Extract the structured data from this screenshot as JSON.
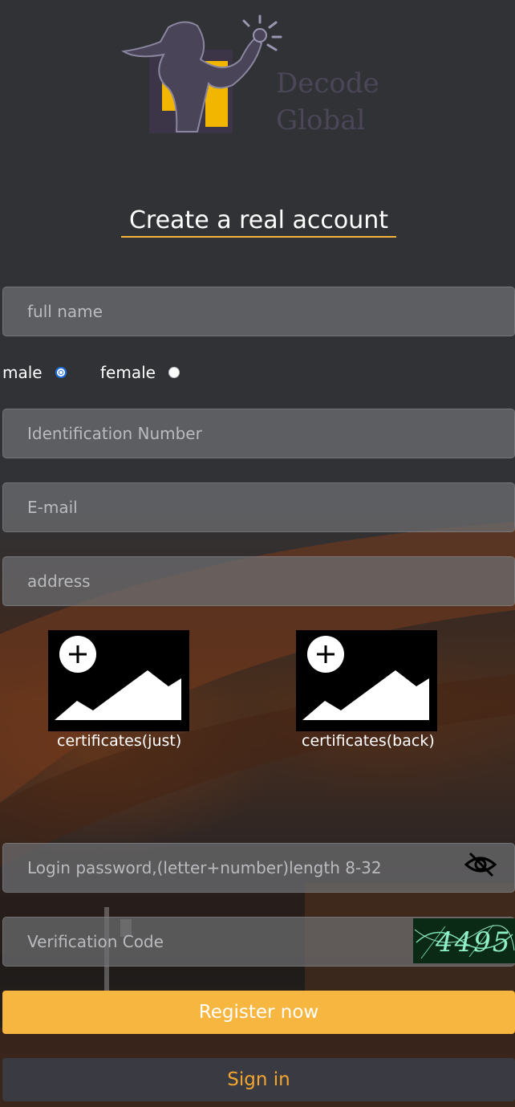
{
  "brand": {
    "line1": "Decode",
    "line2": "Global"
  },
  "form": {
    "title": "Create a real account",
    "full_name_placeholder": "full name",
    "gender": {
      "male": "male",
      "female": "female",
      "selected": "male"
    },
    "id_placeholder": "Identification Number",
    "email_placeholder": "E-mail",
    "address_placeholder": "address",
    "uploads": {
      "front_label": "certificates(just)",
      "back_label": "certificates(back)"
    },
    "password_placeholder": "Login password,(letter+number)length 8-32",
    "captcha_placeholder": "Verification Code",
    "captcha_text": "4495"
  },
  "buttons": {
    "register": "Register now",
    "signin": "Sign in"
  },
  "colors": {
    "accent": "#f6b63f",
    "signin_text": "#f3a52d",
    "background": "#313236"
  },
  "icons": [
    "logo-figure-icon",
    "add-image-icon",
    "eye-off-icon",
    "radio-icon"
  ]
}
